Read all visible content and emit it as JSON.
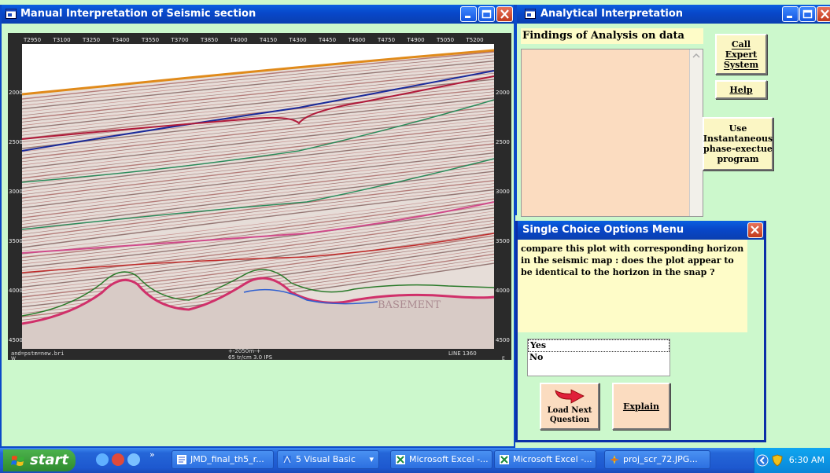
{
  "windows": {
    "manual": {
      "title": "Manual Interpretation of Seismic section",
      "seismic": {
        "trace_labels": [
          "T2950",
          "T3100",
          "T3250",
          "T3400",
          "T3550",
          "T3700",
          "T3850",
          "T4000",
          "T4150",
          "T4300",
          "T4450",
          "T4600",
          "T4750",
          "T4900",
          "T5050",
          "T5200"
        ],
        "depth_left": [
          "2000",
          "2500",
          "3000",
          "3500",
          "4000",
          "4500"
        ],
        "depth_right": [
          "2000",
          "2500",
          "3000",
          "3500",
          "4000",
          "4500"
        ],
        "footer_left": "and=pstm=new.bri",
        "footer_mid": "+-2050m-+",
        "footer_mid2": "65 tr/cm 3.0 IPS",
        "footer_right": "LINE 1360",
        "corner_w": "W",
        "corner_e": "E",
        "basement": "BASEMENT"
      }
    },
    "analytical": {
      "title": "Analytical Interpretation",
      "findings_label": "Findings of Analysis on data",
      "call_expert": "Call\nExpert\nSystem",
      "help": "Help",
      "instantaneous": "Use\nInstantaneous\nphase-exectue\nprogram"
    },
    "options": {
      "title": "Single Choice Options Menu",
      "question": "compare this plot with corresponding horizon in the seismic map : does the plot appear to be identical to the horizon in the snap ?",
      "choices": [
        "Yes",
        "No"
      ],
      "load_next": "Load Next\nQuestion",
      "explain": "Explain"
    }
  },
  "taskbar": {
    "start": "start",
    "chevron": "»",
    "items": [
      {
        "label": "JMD_final_th5_r...",
        "icon": "word-doc-icon"
      },
      {
        "label": "5 Visual Basic",
        "icon": "visual-basic-icon"
      },
      {
        "label": "Microsoft Excel -...",
        "icon": "excel-icon"
      },
      {
        "label": "Microsoft Excel -...",
        "icon": "excel-icon"
      },
      {
        "label": "proj_scr_72.JPG...",
        "icon": "image-viewer-icon"
      }
    ],
    "clock": "6:30 AM"
  },
  "colors": {
    "titlebar": "#0847c9",
    "background": "#ccf8cc",
    "button_face": "#fbf6c4",
    "findings_bg": "#fbdcc0",
    "close_red": "#c23a1c"
  }
}
